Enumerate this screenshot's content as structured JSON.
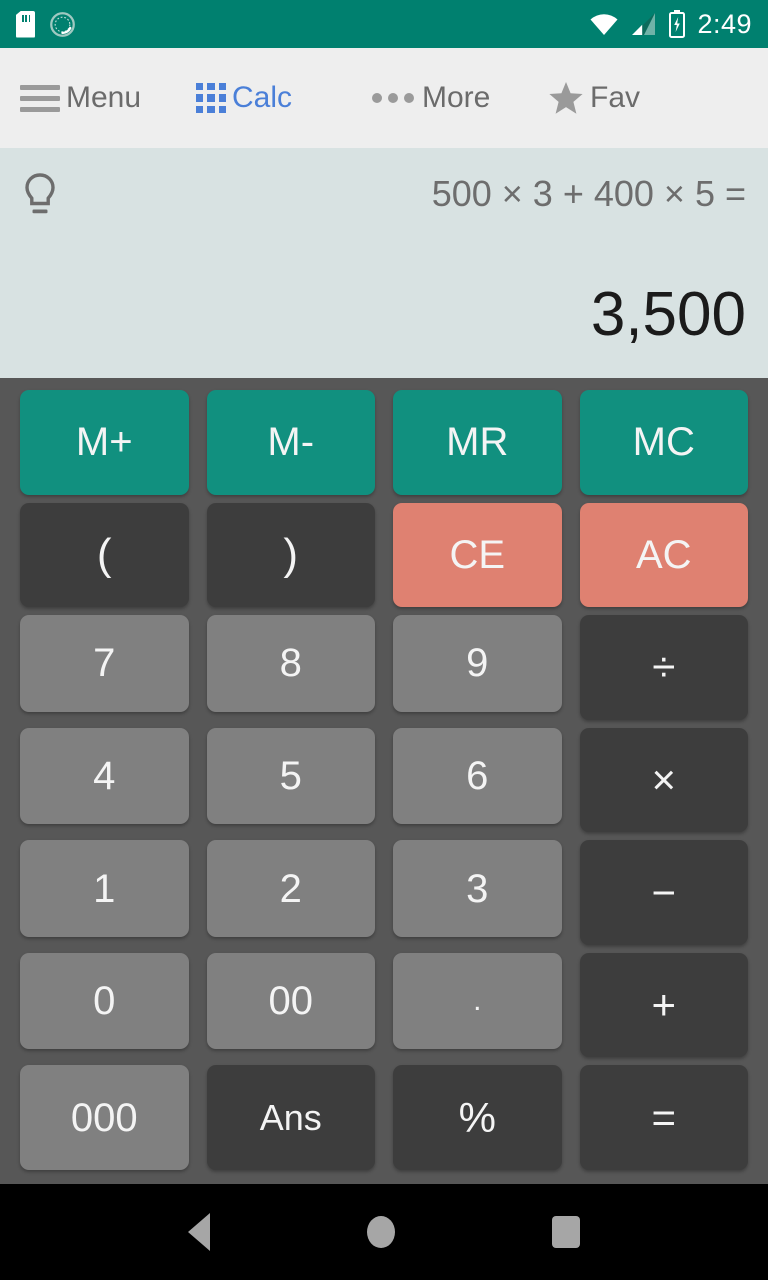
{
  "status_bar": {
    "background": "#00806f",
    "time": "2:49",
    "icons": [
      "sd-card-icon",
      "sync-circle-icon",
      "wifi-icon",
      "signal-icon",
      "battery-charging-icon"
    ]
  },
  "toolbar": {
    "background": "#eeeeee",
    "active_color": "#4a7fd8",
    "items": [
      {
        "label": "Menu",
        "icon": "hamburger-menu-icon",
        "active": false
      },
      {
        "label": "Calc",
        "icon": "grid-apps-icon",
        "active": true
      },
      {
        "label": "More",
        "icon": "more-dots-icon",
        "active": false
      },
      {
        "label": "Fav",
        "icon": "star-icon",
        "active": false
      }
    ]
  },
  "display": {
    "background": "#d8e2e2",
    "hint_icon": "lightbulb-icon",
    "expression": "500 × 3 + 400 × 5 =",
    "result": "3,500"
  },
  "keypad": {
    "background": "#575757",
    "colors": {
      "memory": "#11907f",
      "clear": "#df8171",
      "number": "#808080",
      "operator": "#3d3d3d"
    },
    "rows": [
      [
        {
          "label": "M+",
          "type": "mem"
        },
        {
          "label": "M-",
          "type": "mem"
        },
        {
          "label": "MR",
          "type": "mem"
        },
        {
          "label": "MC",
          "type": "mem"
        }
      ],
      [
        {
          "label": "(",
          "type": "dark"
        },
        {
          "label": ")",
          "type": "dark"
        },
        {
          "label": "CE",
          "type": "warn"
        },
        {
          "label": "AC",
          "type": "warn"
        }
      ],
      [
        {
          "label": "7",
          "type": "num"
        },
        {
          "label": "8",
          "type": "num"
        },
        {
          "label": "9",
          "type": "num"
        },
        {
          "label": "÷",
          "type": "op"
        }
      ],
      [
        {
          "label": "4",
          "type": "num"
        },
        {
          "label": "5",
          "type": "num"
        },
        {
          "label": "6",
          "type": "num"
        },
        {
          "label": "×",
          "type": "op"
        }
      ],
      [
        {
          "label": "1",
          "type": "num"
        },
        {
          "label": "2",
          "type": "num"
        },
        {
          "label": "3",
          "type": "num"
        },
        {
          "label": "−",
          "type": "op"
        }
      ],
      [
        {
          "label": "0",
          "type": "num"
        },
        {
          "label": "00",
          "type": "num"
        },
        {
          "label": ".",
          "type": "num"
        },
        {
          "label": "+",
          "type": "op"
        }
      ],
      [
        {
          "label": "000",
          "type": "num"
        },
        {
          "label": "Ans",
          "type": "op"
        },
        {
          "label": "%",
          "type": "op"
        },
        {
          "label": "=",
          "type": "op"
        }
      ]
    ]
  },
  "nav_bar": {
    "background": "#000000",
    "buttons": [
      "back-icon",
      "home-icon",
      "recents-icon"
    ]
  }
}
